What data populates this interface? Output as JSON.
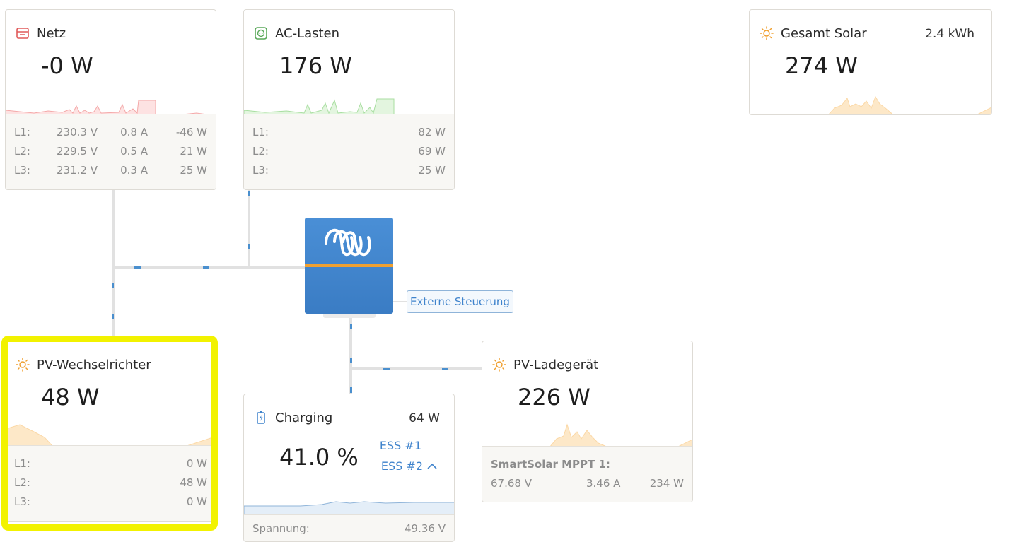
{
  "netz": {
    "title": "Netz",
    "value": "-0 W",
    "rows": [
      {
        "label": "L1:",
        "v": "230.3 V",
        "a": "0.8 A",
        "w": "-46 W"
      },
      {
        "label": "L2:",
        "v": "229.5 V",
        "a": "0.5 A",
        "w": "21 W"
      },
      {
        "label": "L3:",
        "v": "231.2 V",
        "a": "0.3 A",
        "w": "25 W"
      }
    ],
    "colors": {
      "icon": "#e05a5a",
      "spark": "#f4a9a9"
    }
  },
  "ac_lasten": {
    "title": "AC-Lasten",
    "value": "176 W",
    "rows": [
      {
        "label": "L1:",
        "w": "82 W"
      },
      {
        "label": "L2:",
        "w": "69 W"
      },
      {
        "label": "L3:",
        "w": "25 W"
      }
    ],
    "colors": {
      "icon": "#5aa85a",
      "spark": "#a8dea0"
    }
  },
  "gesamt_solar": {
    "title": "Gesamt Solar",
    "energy": "2.4 kWh",
    "value": "274 W",
    "colors": {
      "icon": "#f0a030",
      "spark": "#fbd8a6"
    }
  },
  "inverter": {
    "external_control": "Externe Steuerung",
    "colors": {
      "box": "#3f83cc",
      "stripe": "#f0a030"
    }
  },
  "pv_wechselrichter": {
    "title": "PV-Wechselrichter",
    "value": "48 W",
    "rows": [
      {
        "label": "L1:",
        "w": "0 W"
      },
      {
        "label": "L2:",
        "w": "48 W"
      },
      {
        "label": "L3:",
        "w": "0 W"
      }
    ],
    "highlight_color": "#f2f200"
  },
  "battery": {
    "title": "Charging",
    "power": "64 W",
    "soc": "41.0 %",
    "ess": [
      "ESS #1",
      "ESS #2"
    ],
    "voltage_label": "Spannung:",
    "voltage": "49.36 V",
    "colors": {
      "link": "#3f83cc"
    }
  },
  "pv_ladegeraet": {
    "title": "PV-Ladegerät",
    "value": "226 W",
    "device": "SmartSolar MPPT 1:",
    "v": "67.68 V",
    "a": "3.46 A",
    "w": "234 W"
  }
}
